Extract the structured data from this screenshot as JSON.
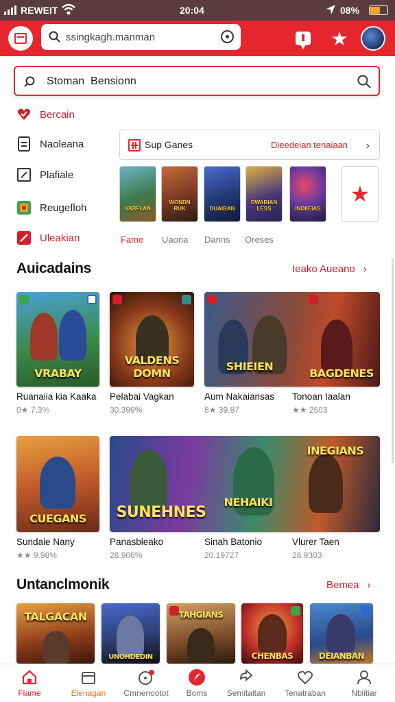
{
  "status_bar": {
    "carrier": "REWEIT",
    "time": "20:04",
    "battery": "08%"
  },
  "header": {
    "search_value": "ssingkagh.manman"
  },
  "main_search": {
    "value": "Stoman  Bensionn"
  },
  "side_menu": [
    {
      "label": "Bercain",
      "icon": "heart-check-icon"
    },
    {
      "label": "Naoleana",
      "icon": "document-icon"
    },
    {
      "label": "Plafiale",
      "icon": "edit-icon"
    },
    {
      "label": "Reugefloh",
      "icon": "puzzle-icon"
    },
    {
      "label": "Uleakian",
      "icon": "arrow-box-icon"
    }
  ],
  "tab_card": {
    "label": "Sup Ganes",
    "right_text": "Dieedeian tenaiaan"
  },
  "thumbnails": [
    {
      "title": "VABFLAN",
      "bg": "#3b7a4a"
    },
    {
      "title": "WONDN RUK",
      "bg": "#7a3a24"
    },
    {
      "title": "DUAIBAN",
      "bg": "#243a72"
    },
    {
      "title": "DWABIAN LESS",
      "bg": "#4a3a7a"
    },
    {
      "title": "INDIIEIAS",
      "bg": "#3a2a5a"
    }
  ],
  "categories": [
    "Fame",
    "Uaona",
    "Danns",
    "Oreses"
  ],
  "section1": {
    "title": "Auicadains",
    "link": "Ieako Aueano",
    "games": [
      {
        "name": "Ruanaiia kia Kaaka",
        "rating": "0★ 7.3%",
        "card_title": "VRABAY"
      },
      {
        "name": "Pelabai Vagkan",
        "rating": "30.399%",
        "card_title": "VALDENS DOMN"
      },
      {
        "name": "Aum Nakaiansas",
        "rating": "8★ 39.87",
        "card_title": "SHIEIEN"
      },
      {
        "name": "Tonoan Iaalan",
        "rating": "★★ 2503",
        "card_title": "BAGDENES"
      }
    ],
    "games2": [
      {
        "name": "Sundaie Nany",
        "rating": "★★ 9.98%",
        "card_title": "CUEGANS"
      },
      {
        "name": "Panasbleako",
        "rating": "28.906%",
        "card_title": "SUNEHNES"
      },
      {
        "name": "Sinah Batonio",
        "rating": "20.19727",
        "card_title": "NEHAIKI"
      },
      {
        "name": "Vlurer Taen",
        "rating": "28.9303",
        "card_title": "INEGIANS"
      }
    ]
  },
  "section2": {
    "title": "Untanclmonik",
    "link": "Bemea",
    "cards": [
      {
        "card_title": "TALGACAN"
      },
      {
        "card_title": "UNOHDEDIN"
      },
      {
        "card_title": "TAHGIANS"
      },
      {
        "card_title": "CHENBAS"
      },
      {
        "card_title": "DEIANBAN"
      }
    ]
  },
  "bottom_nav": [
    {
      "label": "Flame",
      "icon": "home-icon",
      "active": true
    },
    {
      "label": "Elenagan",
      "icon": "box-icon"
    },
    {
      "label": "Cmnenootot",
      "icon": "chat-icon"
    },
    {
      "label": "Boms",
      "icon": "fire-icon"
    },
    {
      "label": "Semitaltan",
      "icon": "share-icon"
    },
    {
      "label": "Tenatraban",
      "icon": "heart-icon"
    },
    {
      "label": "Nblitiar",
      "icon": "user-icon"
    }
  ],
  "colors": {
    "accent": "#e5262e",
    "status_bar": "#5a3b3f"
  }
}
